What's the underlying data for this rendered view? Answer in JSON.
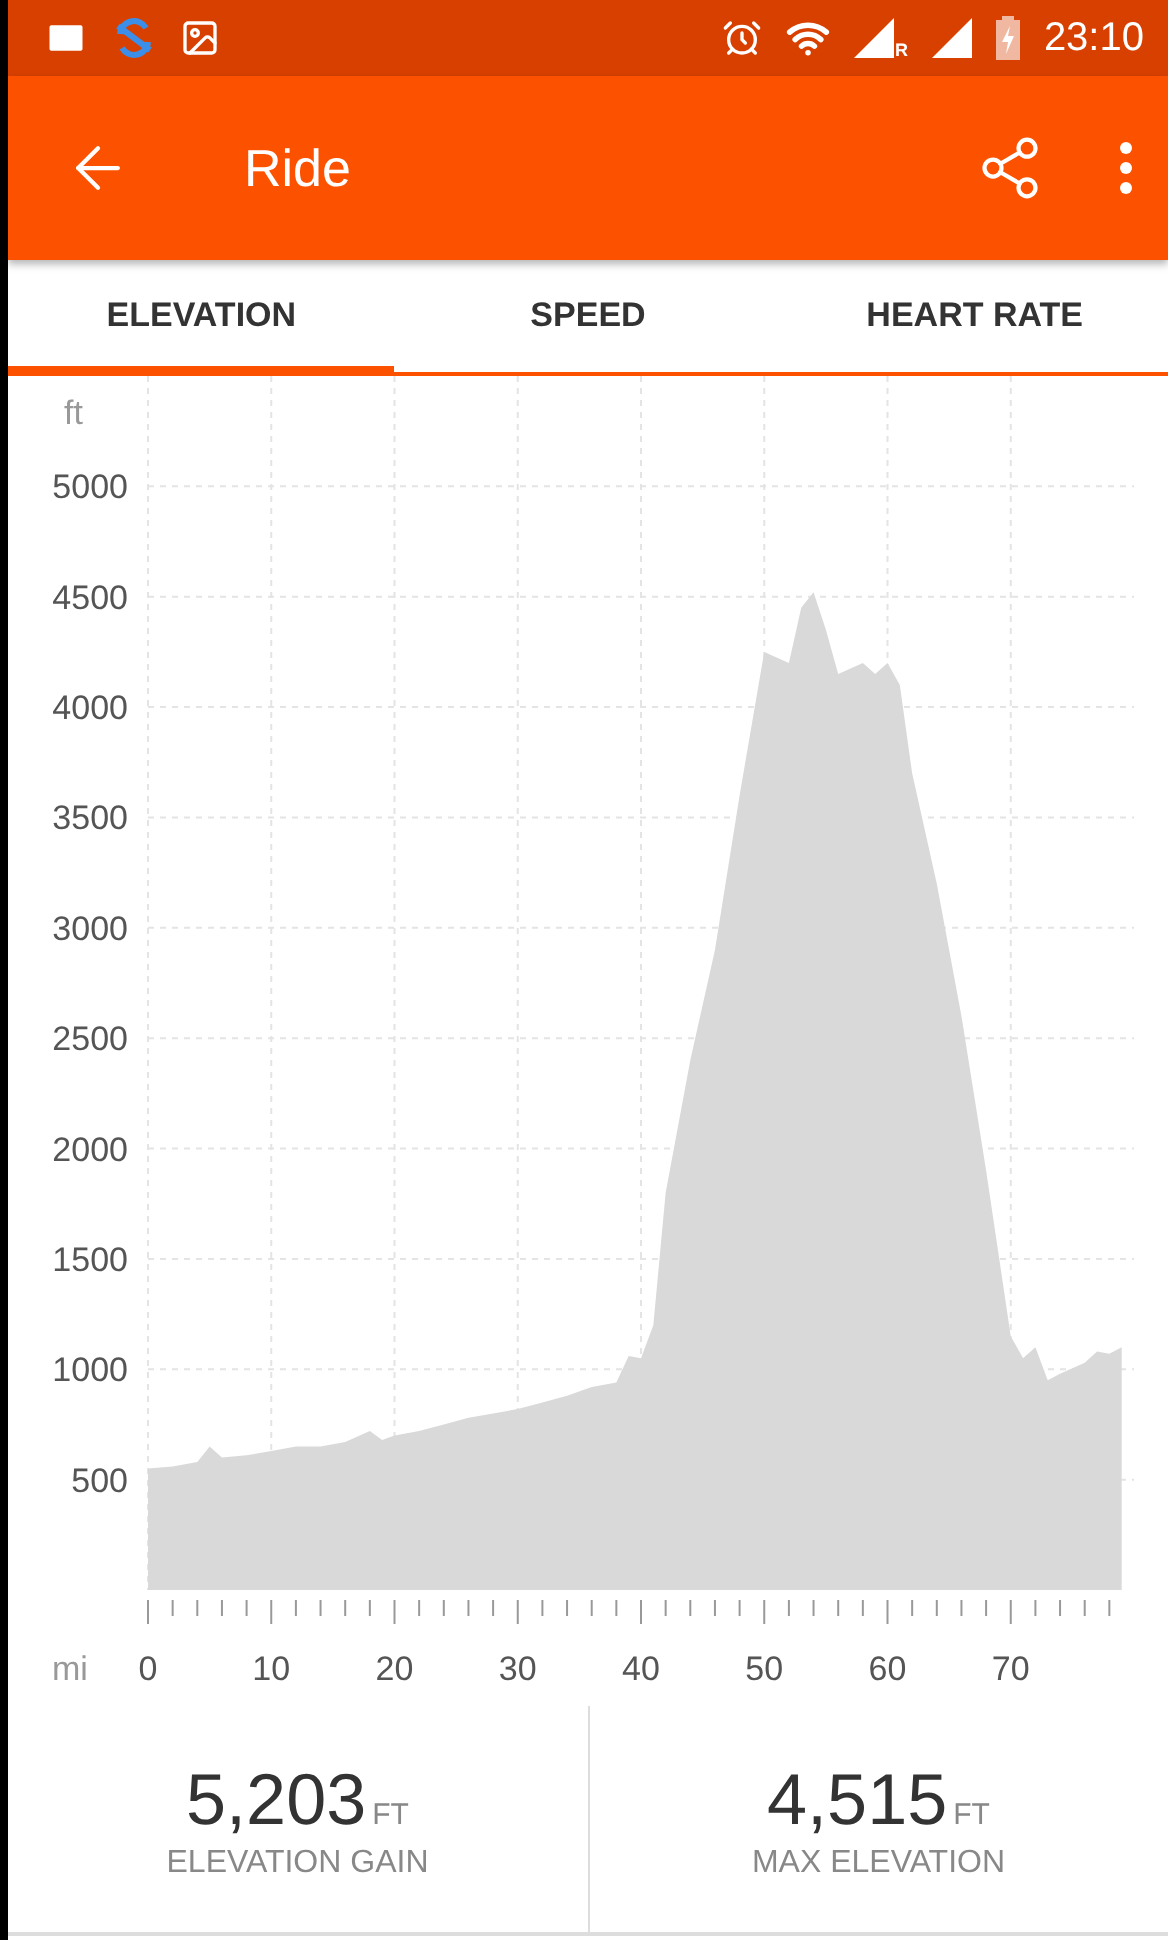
{
  "status_bar": {
    "roaming": "R",
    "time": "23:10"
  },
  "app_bar": {
    "title": "Ride"
  },
  "tabs": [
    {
      "label": "ELEVATION",
      "selected": true
    },
    {
      "label": "SPEED",
      "selected": false
    },
    {
      "label": "HEART RATE",
      "selected": false
    }
  ],
  "chart": {
    "chart_data": {
      "type": "area",
      "ylabel": "ft",
      "xlabel": "mi",
      "xlim": [
        0,
        80
      ],
      "ylim": [
        0,
        5500
      ],
      "grid": true,
      "xticks": [
        0,
        10,
        20,
        30,
        40,
        50,
        60,
        70
      ],
      "yticks": [
        500,
        1000,
        1500,
        2000,
        2500,
        3000,
        3500,
        4000,
        4500,
        5000
      ],
      "x": [
        0,
        2,
        4,
        5,
        6,
        8,
        10,
        12,
        14,
        16,
        18,
        19,
        20,
        22,
        24,
        26,
        28,
        30,
        32,
        34,
        36,
        38,
        39,
        40,
        41,
        42,
        44,
        46,
        48,
        50,
        52,
        53,
        54,
        55,
        56,
        58,
        59,
        60,
        61,
        62,
        64,
        66,
        68,
        70,
        71,
        72,
        73,
        74,
        76,
        77,
        78,
        79
      ],
      "series": [
        {
          "color": "#d9d9d9",
          "values": [
            550,
            560,
            580,
            650,
            600,
            610,
            630,
            650,
            650,
            670,
            720,
            680,
            700,
            720,
            750,
            780,
            800,
            820,
            850,
            880,
            920,
            940,
            1060,
            1050,
            1200,
            1800,
            2400,
            2900,
            3600,
            4250,
            4200,
            4450,
            4520,
            4350,
            4150,
            4200,
            4150,
            4200,
            4100,
            3700,
            3200,
            2600,
            1900,
            1150,
            1050,
            1100,
            950,
            980,
            1030,
            1080,
            1070,
            1100
          ]
        }
      ]
    }
  },
  "stats": [
    {
      "value": "5,203",
      "unit": "FT",
      "label": "ELEVATION GAIN"
    },
    {
      "value": "4,515",
      "unit": "FT",
      "label": "MAX ELEVATION"
    }
  ]
}
